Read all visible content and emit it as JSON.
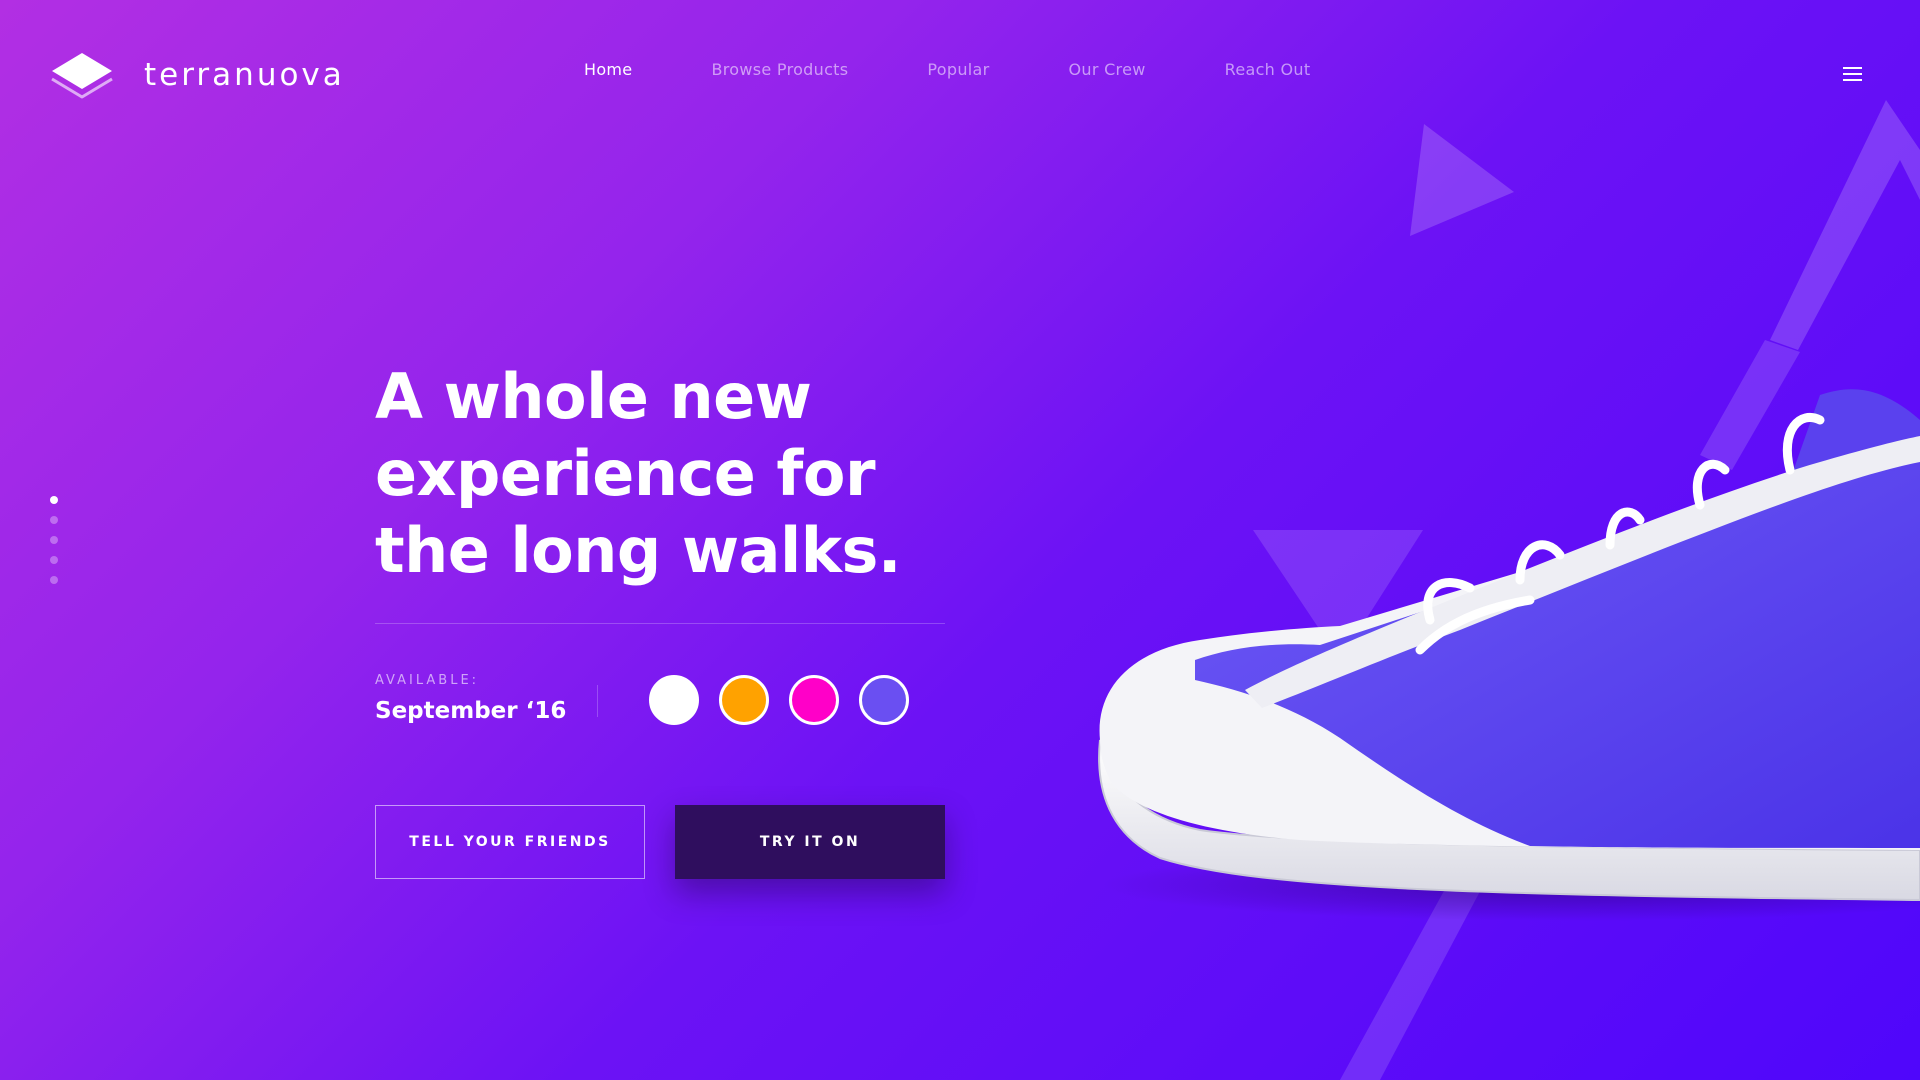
{
  "brand": {
    "name": "terranuova"
  },
  "nav": {
    "items": [
      {
        "label": "Home",
        "active": true
      },
      {
        "label": "Browse Products",
        "active": false
      },
      {
        "label": "Popular",
        "active": false
      },
      {
        "label": "Our Crew",
        "active": false
      },
      {
        "label": "Reach Out",
        "active": false
      }
    ],
    "menu_icon": "hamburger-menu-icon"
  },
  "pager": {
    "count": 5,
    "active_index": 0
  },
  "hero": {
    "headline_lines": [
      "A whole new",
      "experience for",
      "the long walks."
    ],
    "available_label": "AVAILABLE:",
    "available_date": "September ‘16",
    "colors": [
      {
        "name": "white",
        "hex": "#ffffff"
      },
      {
        "name": "orange",
        "hex": "#ffa200"
      },
      {
        "name": "magenta",
        "hex": "#ff00c8"
      },
      {
        "name": "violet",
        "hex": "#6a4ff2"
      }
    ],
    "buttons": {
      "secondary": "TELL YOUR FRIENDS",
      "primary": "TRY IT ON"
    }
  },
  "theme": {
    "gradient_start": "#b22fe3",
    "gradient_end": "#4f06fb",
    "primary_button": "#2f0e5e"
  }
}
